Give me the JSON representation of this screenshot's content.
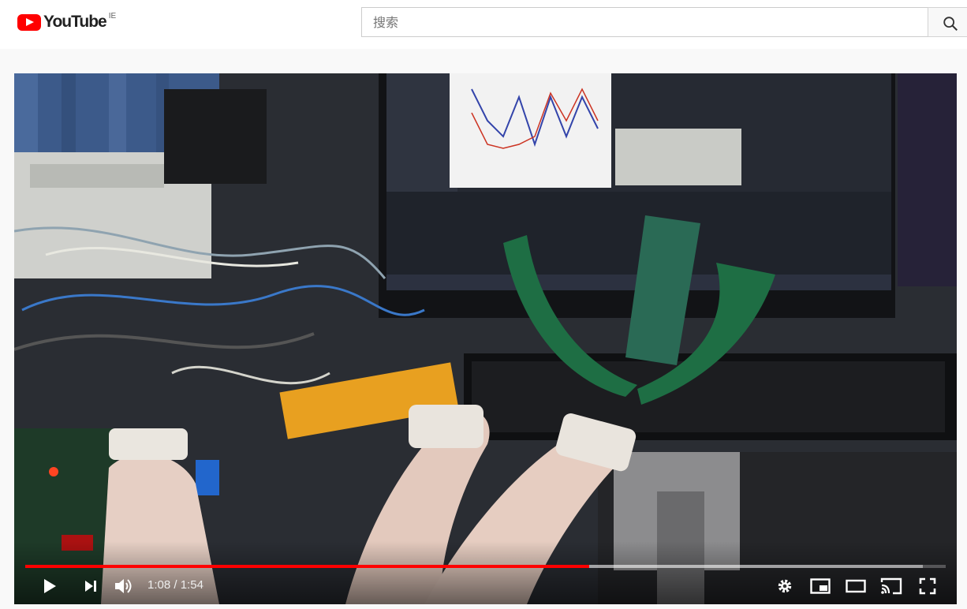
{
  "header": {
    "logo_text": "YouTube",
    "region": "IE",
    "search_placeholder": "搜索"
  },
  "player": {
    "current_time": "1:08",
    "separator": " / ",
    "duration": "1:54",
    "progress_fraction": 0.613,
    "buffer_fraction": 0.975,
    "accent_color": "#ff0000"
  },
  "icons": [
    "search-icon",
    "play-icon",
    "next-icon",
    "volume-icon",
    "settings-icon",
    "miniplayer-icon",
    "theater-icon",
    "cast-icon",
    "fullscreen-icon"
  ]
}
